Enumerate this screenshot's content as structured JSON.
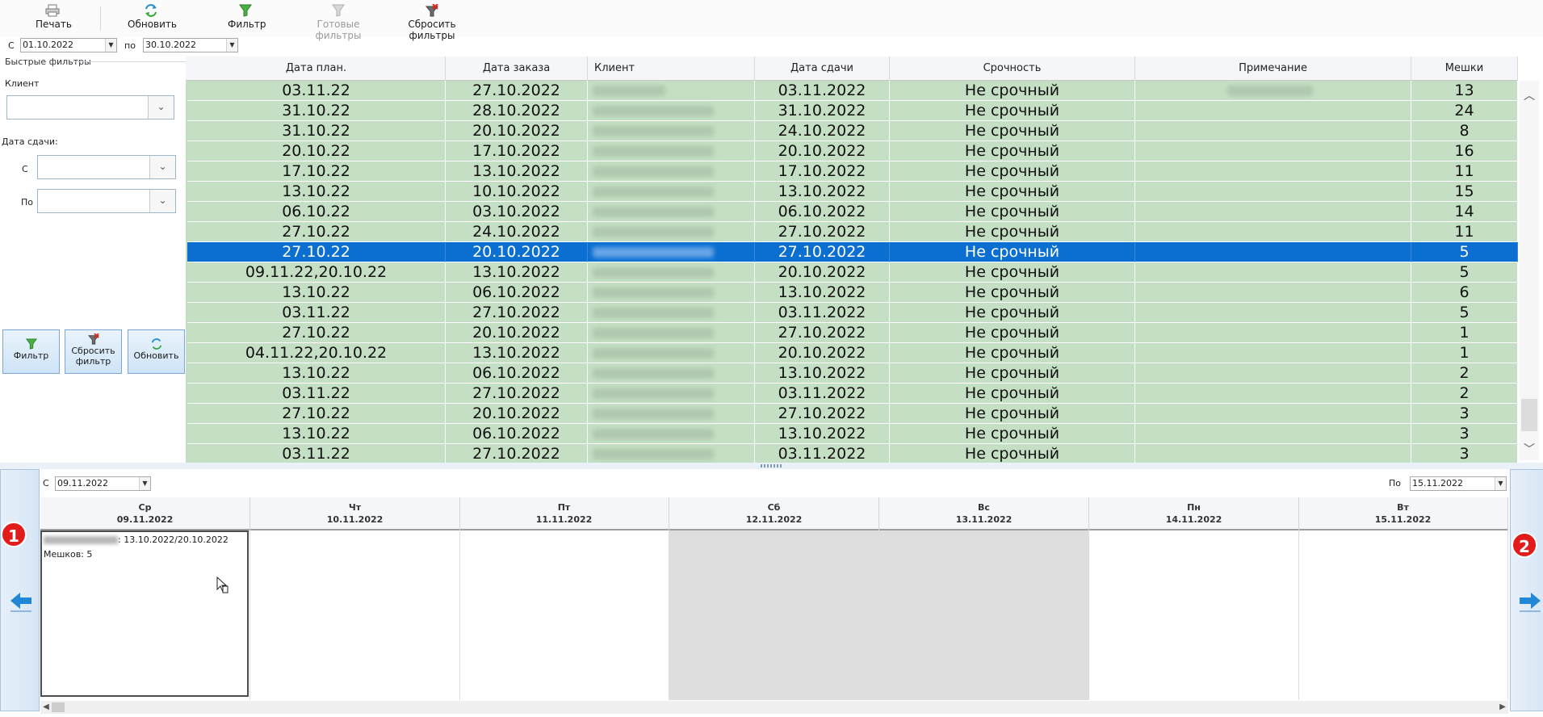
{
  "toolbar": {
    "print": "Печать",
    "refresh": "Обновить",
    "filter": "Фильтр",
    "ready_filters": "Готовые фильтры",
    "reset_filters": "Сбросить фильтры"
  },
  "date_range": {
    "from_label": "С",
    "from_value": "01.10.2022",
    "to_label": "по",
    "to_value": "30.10.2022"
  },
  "quick_filters": {
    "title": "Быстрые фильтры",
    "client_label": "Клиент",
    "client_value": "",
    "delivery_label": "Дата сдачи:",
    "from_label": "С",
    "from_value": "",
    "to_label": "По",
    "to_value": "",
    "buttons": {
      "filter": "Фильтр",
      "reset_line1": "Сбросить",
      "reset_line2": "фильтр",
      "refresh": "Обновить"
    }
  },
  "grid": {
    "columns": [
      "Дата план.",
      "Дата заказа",
      "Клиент",
      "Дата сдачи",
      "Срочность",
      "Примечание",
      "Мешки"
    ],
    "rows": [
      {
        "plan": "03.11.22",
        "order": "27.10.2022",
        "client": "",
        "delivery": "03.11.2022",
        "urgency": "Не срочный",
        "note": "",
        "bags": "13"
      },
      {
        "plan": "31.10.22",
        "order": "28.10.2022",
        "client": "",
        "delivery": "31.10.2022",
        "urgency": "Не срочный",
        "note": "",
        "bags": "24"
      },
      {
        "plan": "31.10.22",
        "order": "20.10.2022",
        "client": "",
        "delivery": "24.10.2022",
        "urgency": "Не срочный",
        "note": "",
        "bags": "8"
      },
      {
        "plan": "20.10.22",
        "order": "17.10.2022",
        "client": "",
        "delivery": "20.10.2022",
        "urgency": "Не срочный",
        "note": "",
        "bags": "16"
      },
      {
        "plan": "17.10.22",
        "order": "13.10.2022",
        "client": "",
        "delivery": "17.10.2022",
        "urgency": "Не срочный",
        "note": "",
        "bags": "11"
      },
      {
        "plan": "13.10.22",
        "order": "10.10.2022",
        "client": "",
        "delivery": "13.10.2022",
        "urgency": "Не срочный",
        "note": "",
        "bags": "15"
      },
      {
        "plan": "06.10.22",
        "order": "03.10.2022",
        "client": "",
        "delivery": "06.10.2022",
        "urgency": "Не срочный",
        "note": "",
        "bags": "14"
      },
      {
        "plan": "27.10.22",
        "order": "24.10.2022",
        "client": "",
        "delivery": "27.10.2022",
        "urgency": "Не срочный",
        "note": "",
        "bags": "11"
      },
      {
        "plan": "27.10.22",
        "order": "20.10.2022",
        "client": "",
        "delivery": "27.10.2022",
        "urgency": "Не срочный",
        "note": "",
        "bags": "5"
      },
      {
        "plan": "09.11.22,20.10.22",
        "order": "13.10.2022",
        "client": "",
        "delivery": "20.10.2022",
        "urgency": "Не срочный",
        "note": "",
        "bags": "5"
      },
      {
        "plan": "13.10.22",
        "order": "06.10.2022",
        "client": "",
        "delivery": "13.10.2022",
        "urgency": "Не срочный",
        "note": "",
        "bags": "6"
      },
      {
        "plan": "03.11.22",
        "order": "27.10.2022",
        "client": "",
        "delivery": "03.11.2022",
        "urgency": "Не срочный",
        "note": "",
        "bags": "5"
      },
      {
        "plan": "27.10.22",
        "order": "20.10.2022",
        "client": "",
        "delivery": "27.10.2022",
        "urgency": "Не срочный",
        "note": "",
        "bags": "1"
      },
      {
        "plan": "04.11.22,20.10.22",
        "order": "13.10.2022",
        "client": "",
        "delivery": "20.10.2022",
        "urgency": "Не срочный",
        "note": "",
        "bags": "1"
      },
      {
        "plan": "13.10.22",
        "order": "06.10.2022",
        "client": "",
        "delivery": "13.10.2022",
        "urgency": "Не срочный",
        "note": "",
        "bags": "2"
      },
      {
        "plan": "03.11.22",
        "order": "27.10.2022",
        "client": "",
        "delivery": "03.11.2022",
        "urgency": "Не срочный",
        "note": "",
        "bags": "2"
      },
      {
        "plan": "27.10.22",
        "order": "20.10.2022",
        "client": "",
        "delivery": "27.10.2022",
        "urgency": "Не срочный",
        "note": "",
        "bags": "3"
      },
      {
        "plan": "13.10.22",
        "order": "06.10.2022",
        "client": "",
        "delivery": "13.10.2022",
        "urgency": "Не срочный",
        "note": "",
        "bags": "3"
      },
      {
        "plan": "03.11.22",
        "order": "27.10.2022",
        "client": "",
        "delivery": "03.11.2022",
        "urgency": "Не срочный",
        "note": "",
        "bags": "3"
      }
    ],
    "selected_row": 8
  },
  "schedule": {
    "from_label": "С",
    "from_value": "09.11.2022",
    "to_label": "По",
    "to_value": "15.11.2022",
    "days": [
      {
        "dow": "Ср",
        "date": "09.11.2022",
        "weekend": false
      },
      {
        "dow": "Чт",
        "date": "10.11.2022",
        "weekend": false
      },
      {
        "dow": "Пт",
        "date": "11.11.2022",
        "weekend": false
      },
      {
        "dow": "Сб",
        "date": "12.11.2022",
        "weekend": true
      },
      {
        "dow": "Вс",
        "date": "13.11.2022",
        "weekend": true
      },
      {
        "dow": "Пн",
        "date": "14.11.2022",
        "weekend": false
      },
      {
        "dow": "Вт",
        "date": "15.11.2022",
        "weekend": false
      }
    ],
    "event": {
      "dates": ": 13.10.2022/20.10.2022",
      "bags": "Мешков: 5"
    },
    "badge_left": "1",
    "badge_right": "2"
  },
  "colors": {
    "row_bg": "#c5dfc4",
    "selected_bg": "#0a6fd1",
    "weekend_bg": "#dedede",
    "badge": "#e21b1b"
  },
  "icons": {
    "print": "printer-icon",
    "refresh": "refresh-icon",
    "filter": "funnel-icon",
    "reset": "funnel-x-icon",
    "prev": "arrow-left-icon",
    "next": "arrow-right-icon"
  }
}
